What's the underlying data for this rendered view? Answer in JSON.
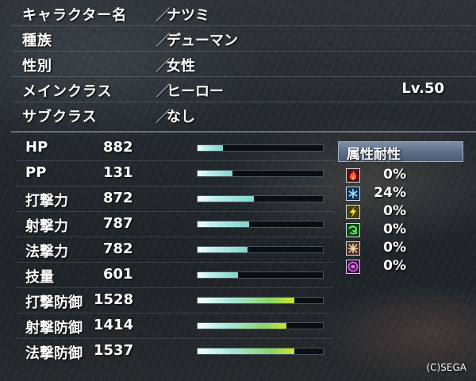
{
  "profile": {
    "rows": [
      {
        "label": "キャラクター名",
        "value": "ナツミ"
      },
      {
        "label": "種族",
        "value": "デューマン"
      },
      {
        "label": "性別",
        "value": "女性"
      },
      {
        "label": "メインクラス",
        "value": "ヒーロー",
        "level": "Lv.50"
      },
      {
        "label": "サブクラス",
        "value": "なし"
      }
    ],
    "separator": "／"
  },
  "stats": [
    {
      "name": "HP",
      "value": "882",
      "fill": 0.2
    },
    {
      "name": "PP",
      "value": "131",
      "fill": 0.28
    },
    {
      "name": "打撃力",
      "value": "872",
      "fill": 0.45
    },
    {
      "name": "射撃力",
      "value": "787",
      "fill": 0.41
    },
    {
      "name": "法撃力",
      "value": "782",
      "fill": 0.4
    },
    {
      "name": "技量",
      "value": "601",
      "fill": 0.32
    },
    {
      "name": "打撃防御",
      "value": "1528",
      "fill": 0.77
    },
    {
      "name": "射撃防御",
      "value": "1414",
      "fill": 0.71
    },
    {
      "name": "法撃防御",
      "value": "1537",
      "fill": 0.77
    }
  ],
  "resistance": {
    "title": "属性耐性",
    "items": [
      {
        "element": "fire-icon",
        "value": "0%",
        "color": "#e03a3a"
      },
      {
        "element": "ice-icon",
        "value": "24%",
        "color": "#4aa6e8"
      },
      {
        "element": "lightning-icon",
        "value": "0%",
        "color": "#e8d22a"
      },
      {
        "element": "wind-icon",
        "value": "0%",
        "color": "#4cc84c"
      },
      {
        "element": "light-icon",
        "value": "0%",
        "color": "#e0a878"
      },
      {
        "element": "dark-icon",
        "value": "0%",
        "color": "#c050d0"
      }
    ]
  },
  "copyright": "(C)SEGA"
}
